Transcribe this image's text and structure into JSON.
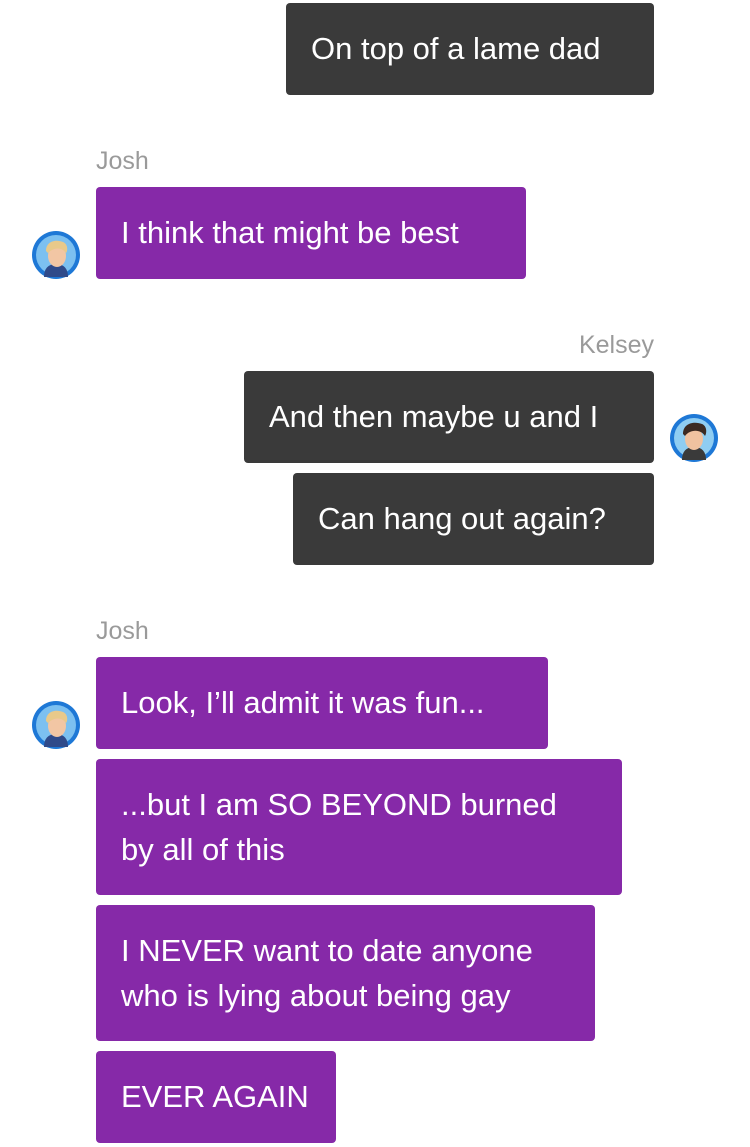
{
  "colors": {
    "outgoing_bubble": "#3a3a3a",
    "incoming_bubble": "#8629a8",
    "sender_name": "#9a9a9a",
    "background": "#ffffff"
  },
  "messages": [
    {
      "sender": "Kelsey",
      "direction": "outgoing",
      "text": "On top of a lame dad"
    },
    {
      "sender": "Josh",
      "direction": "incoming",
      "sender_label": "Josh",
      "avatar": "josh-avatar-icon",
      "text": "I think that might be best"
    },
    {
      "sender": "Kelsey",
      "direction": "outgoing",
      "sender_label": "Kelsey",
      "avatar": "kelsey-avatar-icon",
      "text": "And then maybe u and I"
    },
    {
      "sender": "Kelsey",
      "direction": "outgoing",
      "text": "Can hang out again?"
    },
    {
      "sender": "Josh",
      "direction": "incoming",
      "sender_label": "Josh",
      "avatar": "josh-avatar-icon",
      "text": "Look, I’ll admit it was fun..."
    },
    {
      "sender": "Josh",
      "direction": "incoming",
      "lines": [
        "...but I am SO BEYOND burned",
        "by all of this"
      ]
    },
    {
      "sender": "Josh",
      "direction": "incoming",
      "lines": [
        "I NEVER want to date anyone",
        "who is lying about being gay"
      ]
    },
    {
      "sender": "Josh",
      "direction": "incoming",
      "text": "EVER AGAIN"
    }
  ]
}
